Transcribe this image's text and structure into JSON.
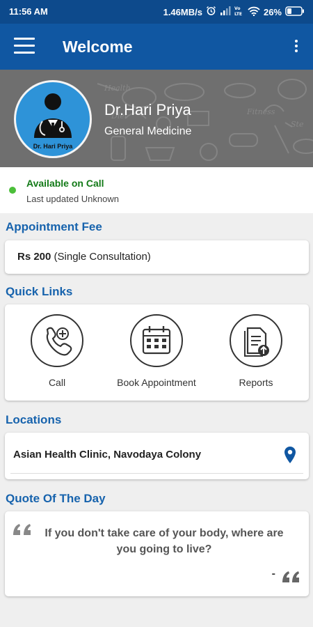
{
  "status_bar": {
    "time": "11:56 AM",
    "speed": "1.46MB/s",
    "battery": "26%",
    "icons": [
      "alarm-icon",
      "signal-icon",
      "volte-icon",
      "wifi-icon",
      "battery-icon"
    ]
  },
  "app_bar": {
    "title": "Welcome",
    "icons": [
      "menu-icon",
      "more-options-icon"
    ]
  },
  "profile": {
    "avatar_label": "Dr. Hari Priya",
    "name": "Dr.Hari Priya",
    "specialty": "General Medicine"
  },
  "availability": {
    "status": "Available on Call",
    "updated": "Last updated Unknown",
    "status_color": "#4cbf3a"
  },
  "appointment_fee": {
    "title": "Appointment Fee",
    "amount": "Rs 200",
    "detail": " (Single Consultation)"
  },
  "quick_links": {
    "title": "Quick Links",
    "items": [
      {
        "label": "Call",
        "icon": "phone-add-icon"
      },
      {
        "label": "Book Appointment",
        "icon": "calendar-icon"
      },
      {
        "label": "Reports",
        "icon": "report-upload-icon"
      }
    ]
  },
  "locations": {
    "title": "Locations",
    "items": [
      {
        "text": "Asian Health Clinic,  Navodaya Colony",
        "icon": "location-pin-icon"
      }
    ]
  },
  "quote": {
    "title": "Quote Of The Day",
    "text": "If you don't take care of your body, where are you going to live?",
    "dash": "-"
  },
  "colors": {
    "primary": "#1057a2",
    "status_bar": "#0d4a8c",
    "section_title": "#1763ad",
    "pin": "#1057a2"
  }
}
